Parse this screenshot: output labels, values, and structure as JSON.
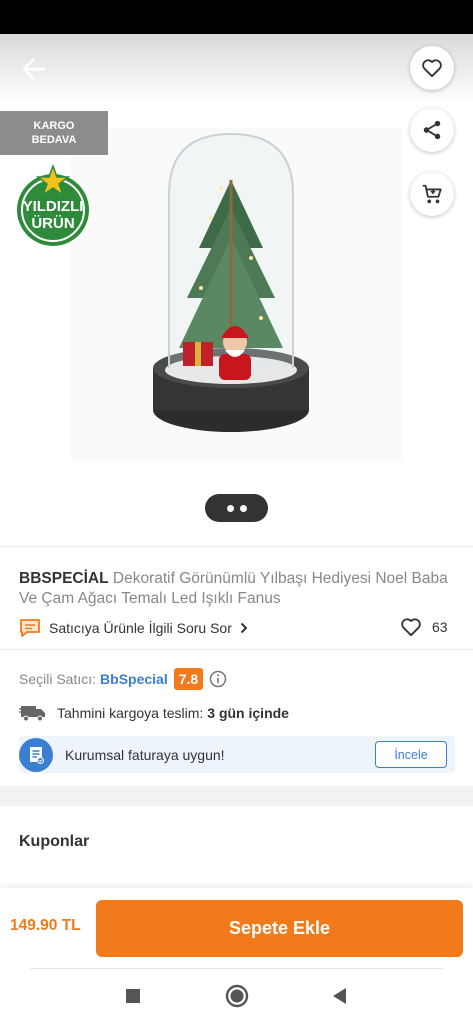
{
  "header": {
    "back_icon": "arrow-left-icon",
    "favorite_icon": "heart-icon",
    "share_icon": "share-icon",
    "cart_icon": "cart-icon"
  },
  "gallery": {
    "cargo_badge": [
      "KARGO",
      "BEDAVA"
    ],
    "star_badge": [
      "YILDIZLI",
      "ÜRÜN"
    ],
    "page_count": 2
  },
  "product": {
    "brand": "BBSPECİAL",
    "title": "Dekoratif Görünümlü Yılbaşı Hediyesi Noel Baba Ve Çam Ağacı Temalı Led Işıklı Fanus",
    "ask_seller_label": "Satıcıya Ürünle İlgili Soru Sor",
    "like_count": "63"
  },
  "seller": {
    "label": "Seçili Satıcı:",
    "name": "BbSpecial",
    "rating": "7.8"
  },
  "shipping": {
    "label": "Tahmini kargoya teslim:",
    "value": "3 gün içinde"
  },
  "invoice": {
    "text": "Kurumsal faturaya uygun!",
    "button": "İncele"
  },
  "coupons": {
    "title": "Kuponlar"
  },
  "footer": {
    "price": "149.90 TL",
    "add_to_cart": "Sepete Ekle"
  },
  "colors": {
    "accent": "#f27a1a",
    "link": "#3b7fd1",
    "badge_green": "#2e8b3a"
  }
}
